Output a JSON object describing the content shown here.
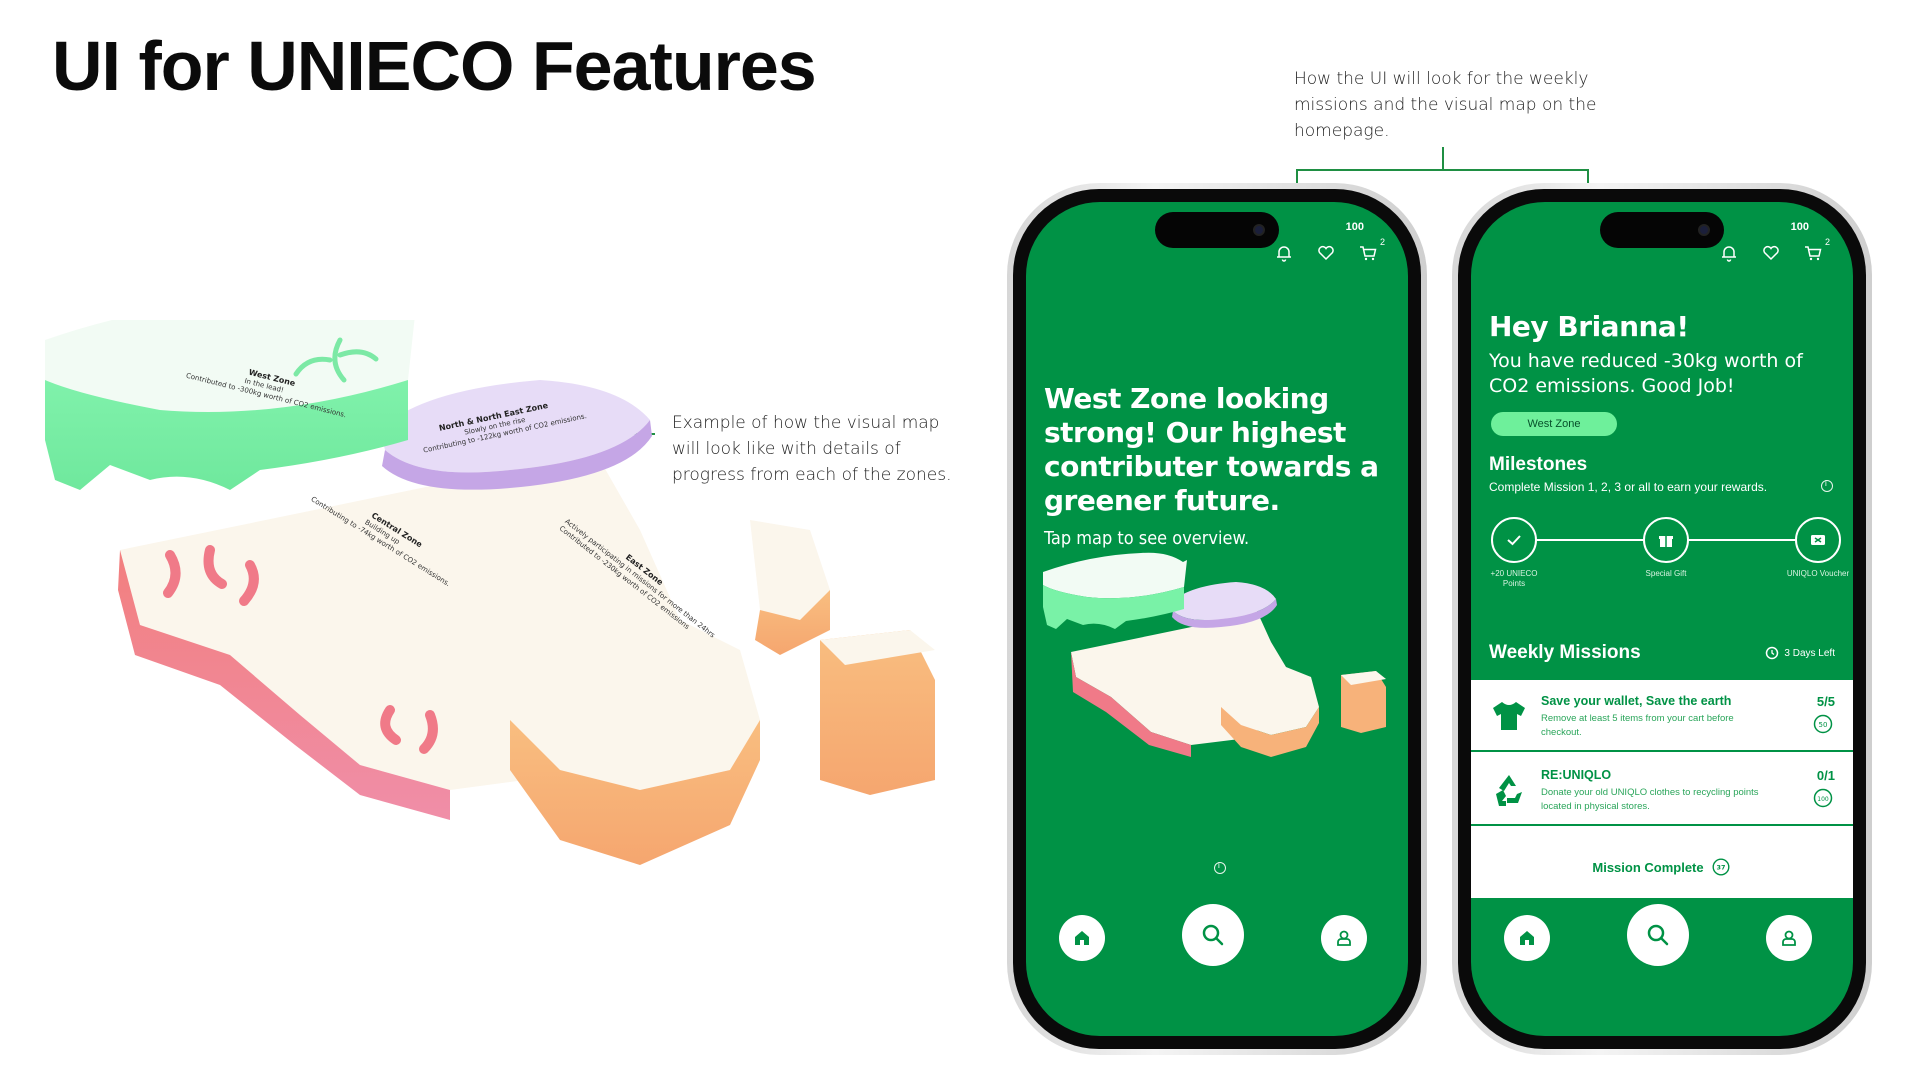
{
  "page": {
    "title": "UI for UNIECO Features"
  },
  "annotations": {
    "map_note": "Example of how the visual map will look like with details of progress from each of the zones.",
    "phones_note": "How the UI will look for the weekly missions and the visual map on the homepage."
  },
  "map": {
    "zones": [
      {
        "name": "West Zone",
        "status": "In the lead!",
        "detail": "Contributed to -300kg worth of CO2 emissions."
      },
      {
        "name": "North & North East Zone",
        "status": "Slowly on the rise",
        "detail": "Contributing to -122kg worth of CO2 emissions."
      },
      {
        "name": "Central Zone",
        "status": "Building up",
        "detail": "Contributing to -74kg worth of CO2 emissions."
      },
      {
        "name": "East Zone",
        "status": "Actively participating in missions for more than 24hrs",
        "detail": "Contributed to -230kg worth of CO2 emissions"
      }
    ],
    "colors": {
      "west": "#79f2a7",
      "north": "#c5a6e6",
      "central": "#f07a88",
      "east": "#f7b27a",
      "top": "#fbf6ec"
    }
  },
  "status_bar": {
    "battery": "100",
    "cart_count": "2"
  },
  "icons": {
    "bell": "bell-icon",
    "heart": "heart-icon",
    "cart": "cart-icon",
    "home": "home-icon",
    "search": "search-icon",
    "profile": "profile-icon",
    "info": "info-icon"
  },
  "phone1": {
    "headline": "West Zone looking strong! Our highest contributer towards a greener future.",
    "subtext": "Tap map to see overview."
  },
  "phone2": {
    "greeting": "Hey Brianna!",
    "message": "You have reduced -30kg worth of CO2 emissions. Good Job!",
    "zone_pill": "West Zone",
    "milestones_title": "Milestones",
    "milestones_sub": "Complete Mission 1, 2, 3 or all to earn your rewards.",
    "milestones": [
      {
        "label": "+20 UNIECO Points",
        "icon": "check-icon"
      },
      {
        "label": "Special Gift",
        "icon": "gift-icon"
      },
      {
        "label": "UNIQLO Voucher",
        "icon": "voucher-icon"
      }
    ],
    "weekly_title": "Weekly Missions",
    "days_left": "3 Days Left",
    "missions": [
      {
        "title": "Save your wallet, Save the earth",
        "desc": "Remove at least 5 items from your cart before checkout.",
        "count": "5/5",
        "points": "50",
        "icon": "tshirt-icon"
      },
      {
        "title": "RE:UNIQLO",
        "desc": "Donate your old UNIQLO clothes to recycling points located in physical stores.",
        "count": "0/1",
        "points": "100",
        "icon": "recycle-icon"
      }
    ],
    "complete_label": "Mission Complete",
    "complete_points": "37"
  },
  "colors": {
    "brand_green": "#009245",
    "pill_green": "#6ef09b",
    "white": "#ffffff"
  }
}
